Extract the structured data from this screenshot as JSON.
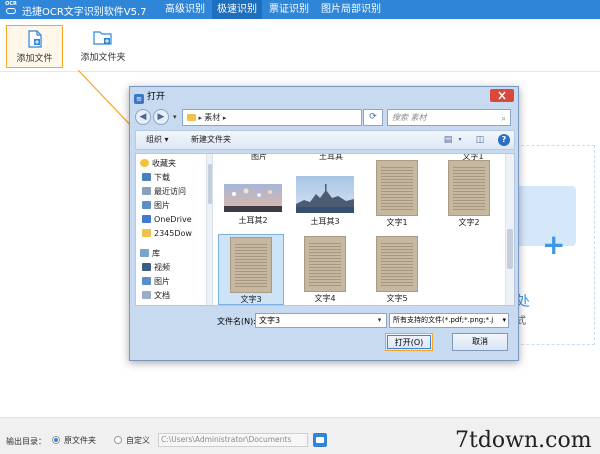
{
  "app": {
    "logo_text": "OCR",
    "title": "迅捷OCR文字识别软件V5.7",
    "menu": [
      {
        "label": "高级识别",
        "active": false
      },
      {
        "label": "极速识别",
        "active": true
      },
      {
        "label": "票证识别",
        "active": false
      },
      {
        "label": "图片局部识别",
        "active": false
      }
    ],
    "accent_color": "#2f86d8",
    "highlight_color": "#f5a623"
  },
  "toolbar": {
    "add_file": "添加文件",
    "add_folder": "添加文件夹"
  },
  "drop_area": {
    "text": "处",
    "sub": "式"
  },
  "dialog": {
    "title": "打开",
    "address": "素材",
    "search_placeholder": "搜索 素材",
    "organize": "组织 ▾",
    "new_folder": "新建文件夹",
    "nav": [
      {
        "label": "收藏夹",
        "icon": "star-icon",
        "group": true
      },
      {
        "label": "下载",
        "icon": "download-folder-icon"
      },
      {
        "label": "最近访问",
        "icon": "recent-icon"
      },
      {
        "label": "图片",
        "icon": "pictures-icon"
      },
      {
        "label": "OneDrive",
        "icon": "onedrive-icon"
      },
      {
        "label": "2345Dow",
        "icon": "folder-icon"
      },
      {
        "label": "库",
        "icon": "library-icon",
        "group": true
      },
      {
        "label": "视频",
        "icon": "videos-icon"
      },
      {
        "label": "图片",
        "icon": "pictures-icon"
      },
      {
        "label": "文档",
        "icon": "documents-icon"
      }
    ],
    "files": [
      {
        "label": "土耳其2",
        "kind": "photo-dusk"
      },
      {
        "label": "土耳其3",
        "kind": "photo-city"
      },
      {
        "label": "文字1",
        "kind": "doc"
      },
      {
        "label": "文字2",
        "kind": "doc"
      },
      {
        "label": "文字3",
        "kind": "doc",
        "selected": true
      },
      {
        "label": "文字4",
        "kind": "doc"
      },
      {
        "label": "文字5",
        "kind": "doc"
      }
    ],
    "top_partial": [
      "图片",
      "土耳其",
      "",
      "文字1"
    ],
    "filename_label": "文件名(N):",
    "filename_value": "文字3",
    "filetype": "所有支持的文件(*.pdf;*.png;*.j",
    "open_button": "打开(O)",
    "cancel_button": "取消"
  },
  "bottom": {
    "output_label": "输出目录：",
    "option_original": "原文件夹",
    "option_custom": "自定义",
    "path": "C:\\Users\\Administrator\\Documents",
    "watermark": "7tdown.com"
  }
}
